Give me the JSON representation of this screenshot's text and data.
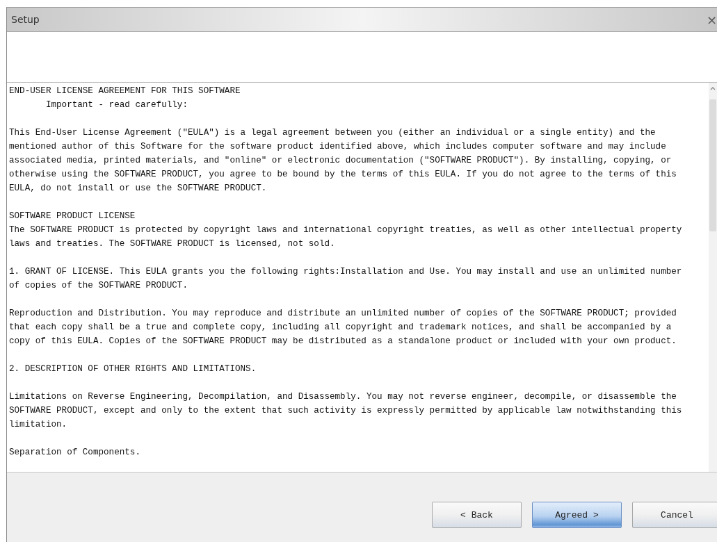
{
  "window": {
    "title": "Setup",
    "close": "×"
  },
  "license": {
    "paragraphs": [
      {
        "lines": [
          "END-USER LICENSE AGREEMENT FOR THIS SOFTWARE",
          "       Important - read carefully:"
        ]
      },
      {
        "lines": [
          "This End-User License Agreement (\"EULA\") is a legal agreement between you (either an individual or a single entity) and the",
          "mentioned author of this Software for the software product identified above, which includes computer software and may include",
          "associated media, printed materials, and \"online\" or electronic documentation (\"SOFTWARE PRODUCT\"). By installing, copying, or",
          "otherwise using the SOFTWARE PRODUCT, you agree to be bound by the terms of this EULA. If you do not agree to the terms of this",
          "EULA, do not install or use the SOFTWARE PRODUCT."
        ]
      },
      {
        "lines": [
          "SOFTWARE PRODUCT LICENSE",
          "The SOFTWARE PRODUCT is protected by copyright laws and international copyright treaties, as well as other intellectual property",
          "laws and treaties. The SOFTWARE PRODUCT is licensed, not sold."
        ]
      },
      {
        "lines": [
          "1. GRANT OF LICENSE. This EULA grants you the following rights:Installation and Use. You may install and use an unlimited number",
          "of copies of the SOFTWARE PRODUCT."
        ]
      },
      {
        "lines": [
          "Reproduction and Distribution. You may reproduce and distribute an unlimited number of copies of the SOFTWARE PRODUCT; provided",
          "that each copy shall be a true and complete copy, including all copyright and trademark notices, and shall be accompanied by a",
          "copy of this EULA. Copies of the SOFTWARE PRODUCT may be distributed as a standalone product or included with your own product."
        ]
      },
      {
        "lines": [
          "2. DESCRIPTION OF OTHER RIGHTS AND LIMITATIONS."
        ]
      },
      {
        "lines": [
          "Limitations on Reverse Engineering, Decompilation, and Disassembly. You may not reverse engineer, decompile, or disassemble the",
          "SOFTWARE PRODUCT, except and only to the extent that such activity is expressly permitted by applicable law notwithstanding this",
          "limitation."
        ]
      },
      {
        "lines": [
          "Separation of Components."
        ]
      }
    ]
  },
  "buttons": [
    {
      "label": "< Back",
      "default": false
    },
    {
      "label": "Agreed >",
      "default": true
    },
    {
      "label": "Cancel",
      "default": false
    }
  ]
}
